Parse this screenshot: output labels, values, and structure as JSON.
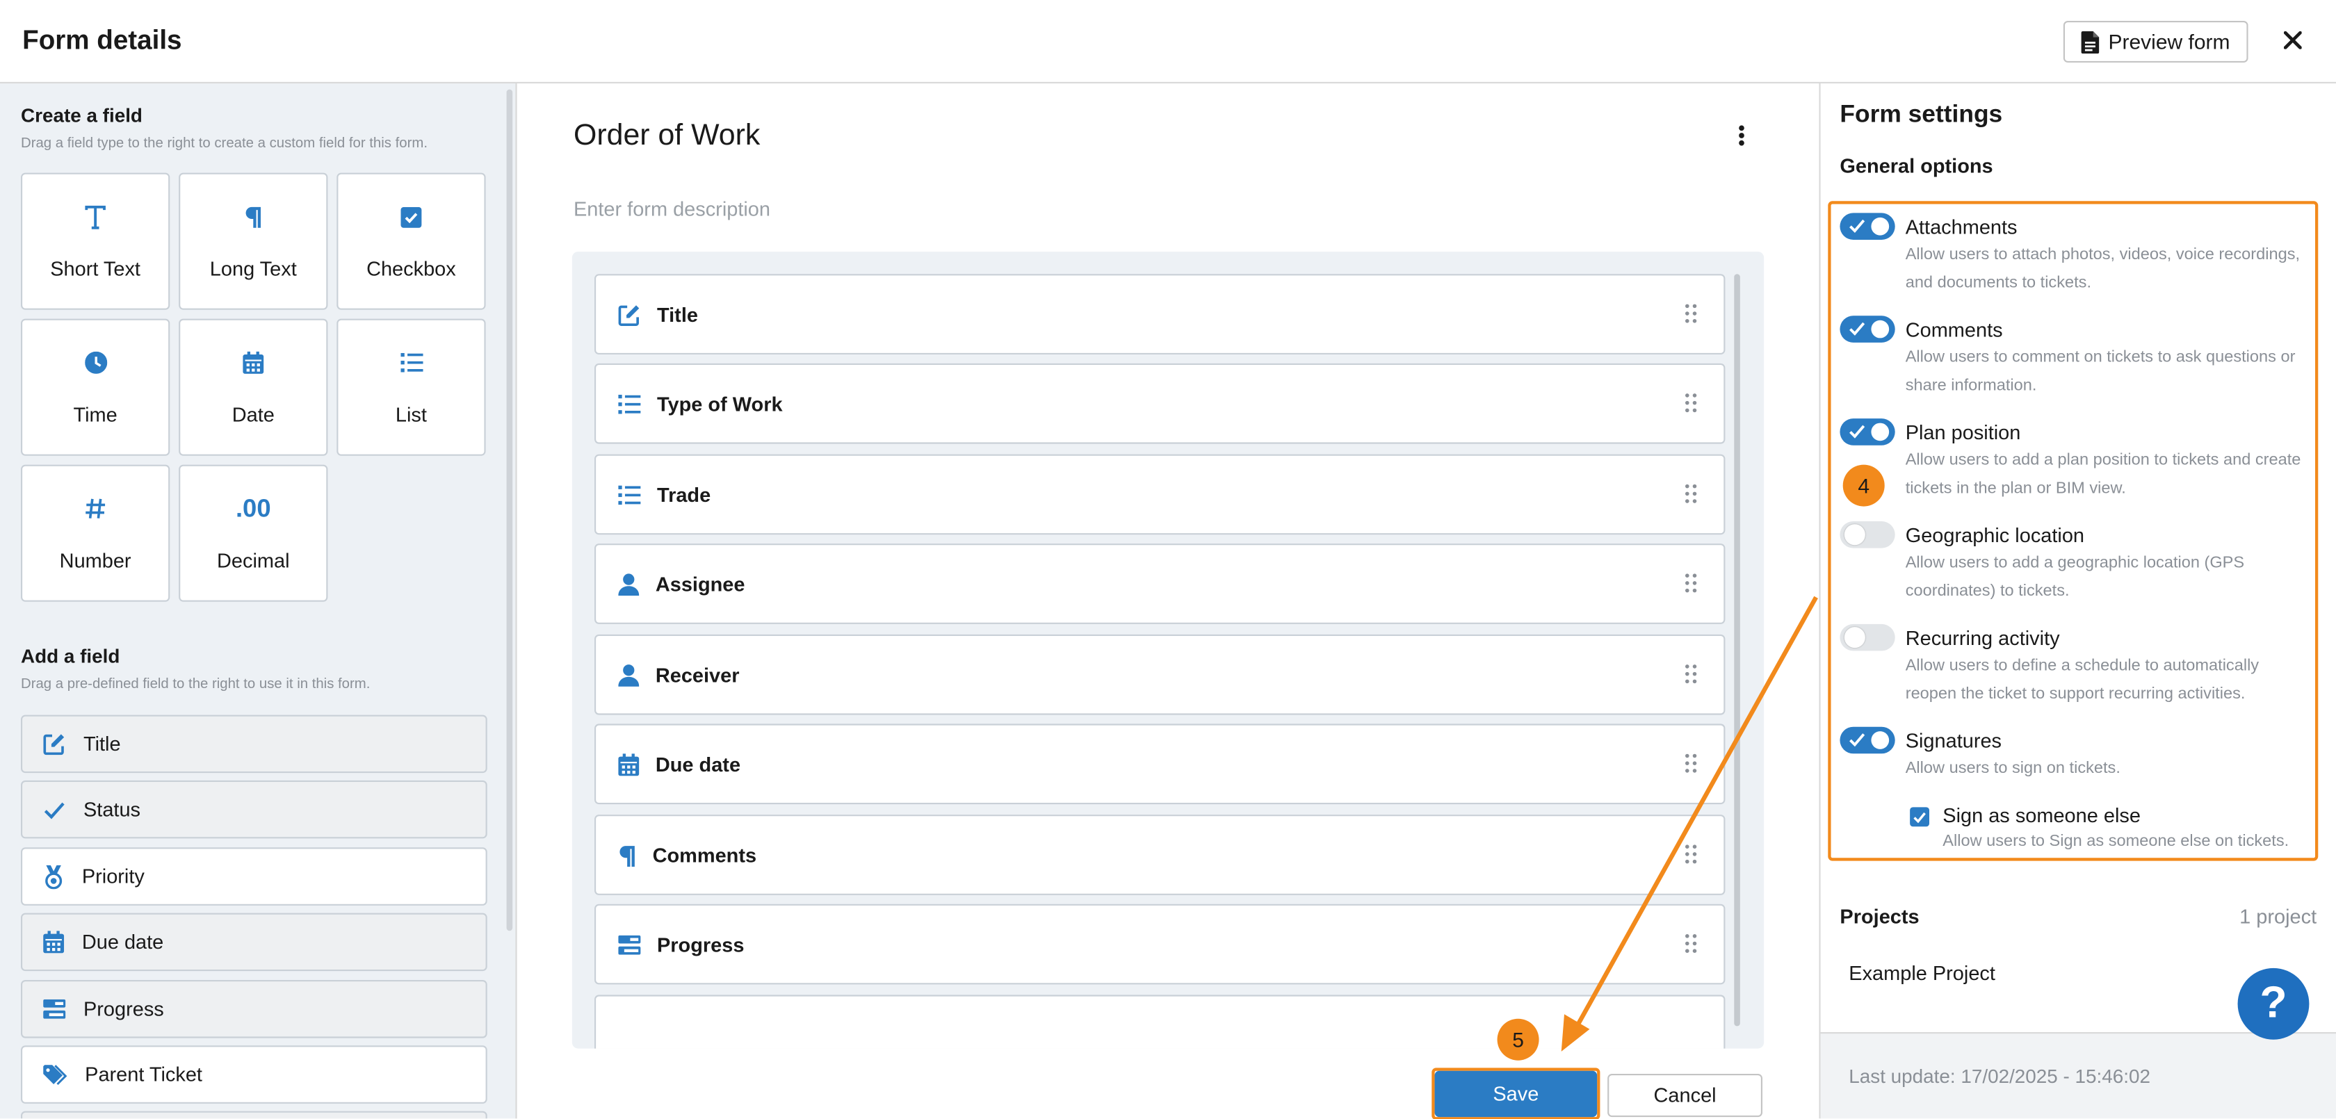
{
  "header": {
    "title": "Form details",
    "preview_label": "Preview form"
  },
  "create_field": {
    "title": "Create a field",
    "subtitle": "Drag a field type to the right to create a custom field for this form.",
    "types": [
      {
        "label": "Short Text",
        "icon": "text-icon"
      },
      {
        "label": "Long Text",
        "icon": "paragraph-icon"
      },
      {
        "label": "Checkbox",
        "icon": "checkbox-icon"
      },
      {
        "label": "Time",
        "icon": "clock-icon"
      },
      {
        "label": "Date",
        "icon": "calendar-icon"
      },
      {
        "label": "List",
        "icon": "list-icon"
      },
      {
        "label": "Number",
        "icon": "hash-icon"
      },
      {
        "label": "Decimal",
        "icon": "decimal-icon"
      }
    ]
  },
  "add_field": {
    "title": "Add a field",
    "subtitle": "Drag a pre-defined field to the right to use it in this form.",
    "items": [
      {
        "label": "Title",
        "icon": "edit-icon"
      },
      {
        "label": "Status",
        "icon": "check-icon"
      },
      {
        "label": "Priority",
        "icon": "medal-icon"
      },
      {
        "label": "Due date",
        "icon": "calendar-icon"
      },
      {
        "label": "Progress",
        "icon": "progress-icon"
      },
      {
        "label": "Parent Ticket",
        "icon": "tag-icon"
      }
    ]
  },
  "form": {
    "title": "Order of Work",
    "description_placeholder": "Enter form description",
    "fields": [
      {
        "label": "Title",
        "icon": "edit-icon"
      },
      {
        "label": "Type of Work",
        "icon": "list-icon"
      },
      {
        "label": "Trade",
        "icon": "list-icon"
      },
      {
        "label": "Assignee",
        "icon": "person-icon"
      },
      {
        "label": "Receiver",
        "icon": "person-icon"
      },
      {
        "label": "Due date",
        "icon": "calendar-icon"
      },
      {
        "label": "Comments",
        "icon": "paragraph-icon"
      },
      {
        "label": "Progress",
        "icon": "progress-icon"
      }
    ],
    "save_label": "Save",
    "cancel_label": "Cancel"
  },
  "settings": {
    "title": "Form settings",
    "general_title": "General options",
    "options": [
      {
        "label": "Attachments",
        "enabled": true,
        "desc1": "Allow users to attach photos, videos, voice recordings,",
        "desc2": "and documents to tickets."
      },
      {
        "label": "Comments",
        "enabled": true,
        "desc1": "Allow users to comment on tickets to ask questions or",
        "desc2": "share information."
      },
      {
        "label": "Plan position",
        "enabled": true,
        "desc1": "Allow users to add a plan position to tickets and create",
        "desc2": "tickets in the plan or BIM view."
      },
      {
        "label": "Geographic location",
        "enabled": false,
        "desc1": "Allow users to add a geographic location (GPS",
        "desc2": "coordinates) to tickets."
      },
      {
        "label": "Recurring activity",
        "enabled": false,
        "desc1": "Allow users to define a schedule to automatically",
        "desc2": "reopen the ticket to support recurring activities."
      },
      {
        "label": "Signatures",
        "enabled": true,
        "desc1": "Allow users to sign on tickets.",
        "desc2": ""
      }
    ],
    "sub_option": {
      "label": "Sign as someone else",
      "checked": true,
      "desc": "Allow users to Sign as someone else on tickets."
    },
    "projects_title": "Projects",
    "projects_count": "1 project",
    "project_name": "Example Project",
    "last_update": "Last update: 17/02/2025 - 15:46:02"
  },
  "annotations": {
    "step4": "4",
    "step5": "5"
  },
  "help_label": "?",
  "colors": {
    "accent": "#2b7cc4",
    "highlight": "#f28a1c",
    "panel_bg": "#edf1f5"
  }
}
